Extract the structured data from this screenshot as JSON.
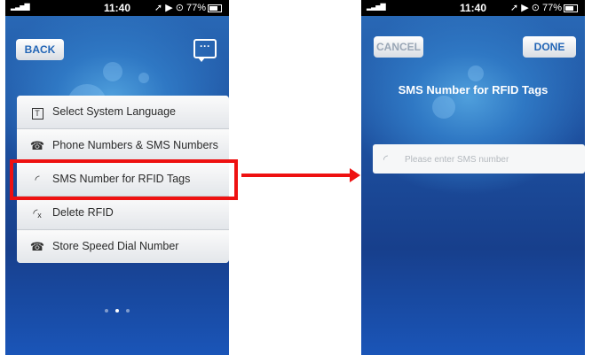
{
  "status_bar": {
    "signal": "▂▃▅▇",
    "time": "11:40",
    "right_text": "➚ ▶ ⊙ 77%"
  },
  "left_screen": {
    "back_label": "BACK",
    "chat_icon": "chat-bubble-icon",
    "menu": [
      {
        "icon": "T",
        "icon_name": "text-icon",
        "label": "Select System Language"
      },
      {
        "icon": "☎",
        "icon_name": "phone-plus-icon",
        "label": "Phone Numbers & SMS Numbers"
      },
      {
        "icon": "◜",
        "icon_name": "rfid-signal-icon",
        "label": "SMS Number for RFID Tags"
      },
      {
        "icon": "◜ₓ",
        "icon_name": "rfid-delete-icon",
        "label": "Delete RFID"
      },
      {
        "icon": "☎",
        "icon_name": "phone-icon",
        "label": "Store Speed Dial Number"
      }
    ],
    "page_dots": {
      "count": 3,
      "active": 2
    }
  },
  "right_screen": {
    "cancel_label": "CANCEL",
    "done_label": "DONE",
    "title": "SMS Number for RFID Tags",
    "input": {
      "icon": "rfid-signal-icon",
      "placeholder": "Please enter SMS number",
      "value": ""
    }
  },
  "colors": {
    "highlight": "#ee1111",
    "accent": "#2265b6",
    "background_blue": "#1d4f9e"
  }
}
